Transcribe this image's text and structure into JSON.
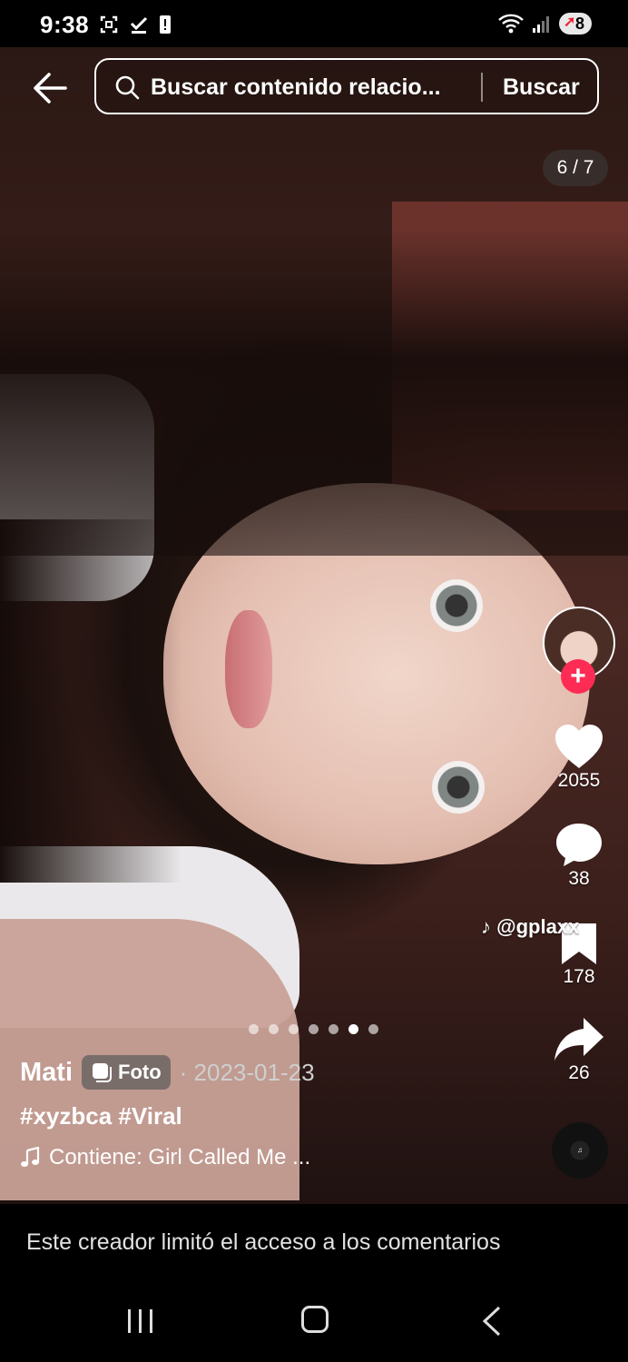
{
  "status_bar": {
    "time": "9:38",
    "battery": "8"
  },
  "search": {
    "placeholder": "Buscar contenido relacio...",
    "button_label": "Buscar"
  },
  "page_counter": "6 / 7",
  "slides": {
    "total": 7,
    "current": 6
  },
  "actions": {
    "likes": "2055",
    "comments": "38",
    "bookmarks": "178",
    "shares": "26"
  },
  "watermark": "@gplaxx",
  "post": {
    "author": "Mati",
    "badge": "Foto",
    "date": "· 2023-01-23",
    "hashtags": "#xyzbca #Viral",
    "sound": "Contiene: Girl Called Me ..."
  },
  "comments_notice": "Este creador limitó el acceso a los comentarios",
  "colors": {
    "follow": "#fe2c55",
    "background": "#000000"
  },
  "icons": [
    "back-arrow-icon",
    "search-icon",
    "heart-icon",
    "comment-icon",
    "bookmark-icon",
    "share-icon",
    "music-note-icon",
    "foto-icon",
    "tiktok-icon"
  ]
}
